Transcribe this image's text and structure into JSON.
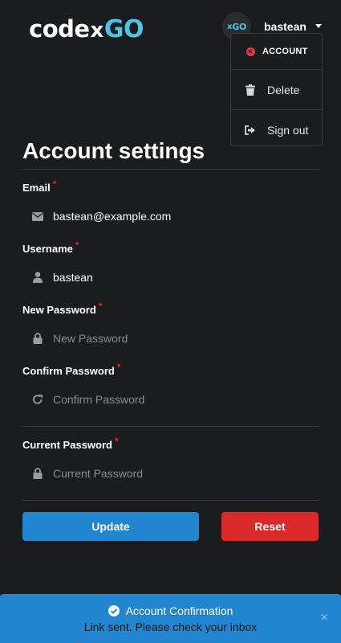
{
  "header": {
    "logo": {
      "code": "code",
      "x": "x",
      "go": "GO"
    },
    "avatar": {
      "x": "x",
      "go": "GO"
    },
    "username": "bastean"
  },
  "menu": {
    "items": [
      {
        "label": "ACCOUNT",
        "icon": "x-circle-icon"
      },
      {
        "label": "Delete",
        "icon": "trash-icon"
      },
      {
        "label": "Sign out",
        "icon": "sign-out-icon"
      }
    ]
  },
  "page": {
    "title": "Account settings"
  },
  "form": {
    "required_mark": "*",
    "email": {
      "label": "Email",
      "value": "bastean@example.com",
      "icon": "envelope-icon"
    },
    "username": {
      "label": "Username",
      "value": "bastean",
      "icon": "user-icon"
    },
    "new_password": {
      "label": "New Password",
      "placeholder": "New Password",
      "icon": "lock-icon"
    },
    "confirm_password": {
      "label": "Confirm Password",
      "placeholder": "Confirm Password",
      "icon": "redo-icon"
    },
    "current_password": {
      "label": "Current Password",
      "placeholder": "Current Password",
      "icon": "lock-icon"
    }
  },
  "buttons": {
    "update": "Update",
    "reset": "Reset"
  },
  "toast": {
    "title": "Account Confirmation",
    "message": "Link sent. Please check your inbox",
    "close": "×"
  },
  "colors": {
    "background": "#1b1c1d",
    "accent": "#4fc3e8",
    "primary": "#2185d0",
    "danger": "#db2828"
  }
}
